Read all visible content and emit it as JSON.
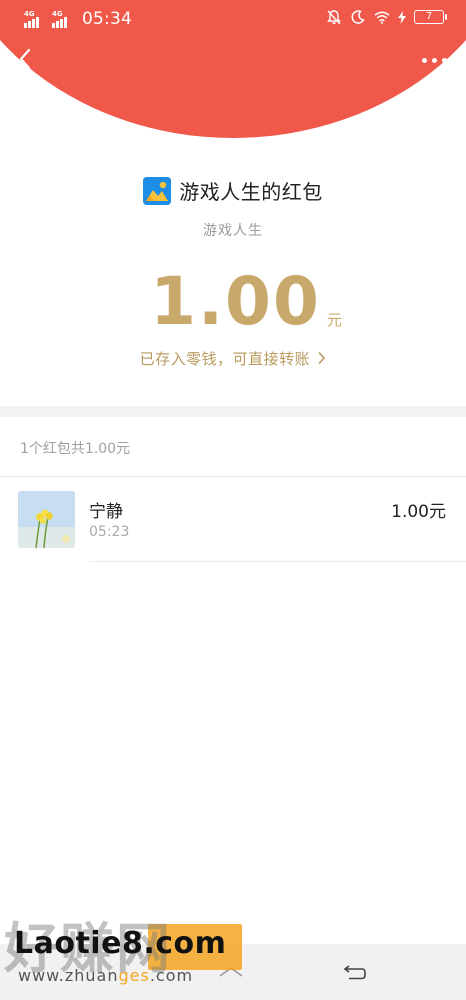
{
  "status_bar": {
    "network_1": "4G",
    "network_2": "4G",
    "time": "05:34",
    "battery": "7"
  },
  "header": {
    "back_icon": "chevron-left-icon",
    "more_icon": "more-dots-icon",
    "background_color": "#f0584a"
  },
  "packet": {
    "title": "游戏人生的红包",
    "sender": "游戏人生",
    "amount": "1.00",
    "unit": "元",
    "saved_note": "已存入零钱，可直接转账",
    "amount_color": "#c9a86b"
  },
  "summary": {
    "text": "1个红包共1.00元"
  },
  "records": [
    {
      "name": "宁静",
      "time": "05:23",
      "amount": "1.00元"
    }
  ],
  "watermark": {
    "big": "好赚网",
    "main": "Laotie8.com",
    "sub_prefix": "www.zhuan",
    "sub_accent": "ges",
    "sub_suffix": ".com"
  },
  "nav": {
    "home_icon": "home-icon",
    "back_icon": "back-arrow-icon"
  }
}
